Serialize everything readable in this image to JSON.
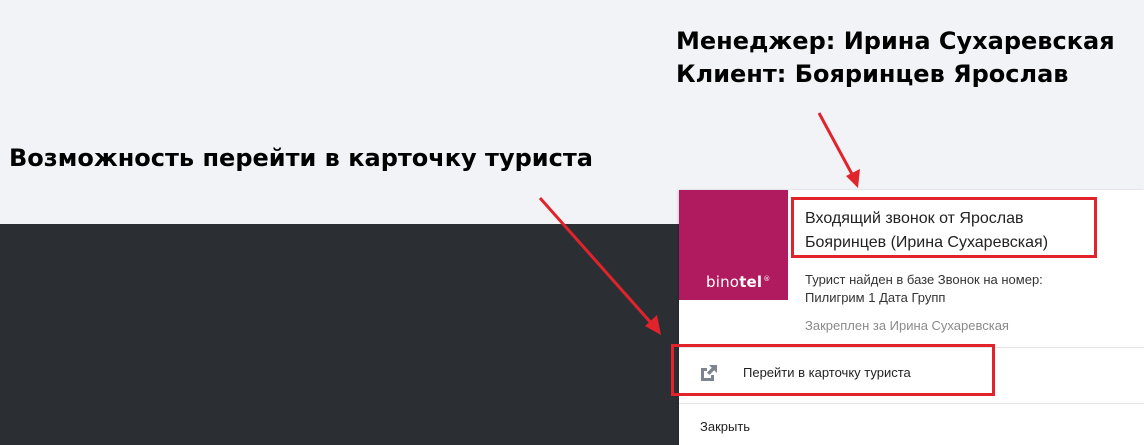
{
  "annotations": {
    "manager_line": "Менеджер: Ирина Сухаревская",
    "client_line": "Клиент: Бояринцев Ярослав",
    "feature_line": "Возможность перейти в карточку туриста"
  },
  "notification": {
    "logo": {
      "text_regular": "bino",
      "text_bold": "tel",
      "registered_mark": "®",
      "color": "#b01a5e"
    },
    "title_line1": "Входящий звонок от Ярослав",
    "title_line2": "Бояринцев (Ирина Сухаревская)",
    "details_line1": "Турист найден в базе Звонок на номер:",
    "details_line2": "Пилигрим 1 Дата Групп",
    "assigned_text": "Закреплен за Ирина Сухаревская",
    "action": {
      "label": "Перейти в карточку туриста",
      "icon": "open-external-icon"
    },
    "close_label": "Закрыть"
  },
  "colors": {
    "annotation_red": "#e1242b",
    "dark_background": "#2b2f33",
    "light_background": "#f1f3f6",
    "icon_gray": "#7d8490"
  }
}
